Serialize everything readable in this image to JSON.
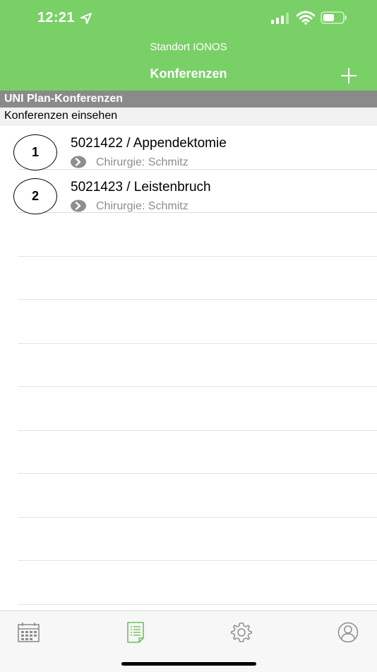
{
  "status_bar": {
    "time": "12:21"
  },
  "header": {
    "location": "Standort IONOS",
    "title": "Konferenzen",
    "bg_color": "#79d066"
  },
  "section": {
    "title": "UNI Plan-Konferenzen",
    "subtitle": "Konferenzen einsehen"
  },
  "items": [
    {
      "number": "1",
      "title": "5021422 / Appendektomie",
      "subtitle": "Chirurgie: Schmitz"
    },
    {
      "number": "2",
      "title": "5021423 / Leistenbruch",
      "subtitle": "Chirurgie: Schmitz"
    }
  ],
  "tabbar": {
    "tabs": [
      {
        "icon": "calendar-icon",
        "active": false
      },
      {
        "icon": "list-document-icon",
        "active": true
      },
      {
        "icon": "gear-icon",
        "active": false
      },
      {
        "icon": "profile-icon",
        "active": false
      }
    ],
    "active_color": "#6cc25a",
    "inactive_color": "#8e8e8e"
  }
}
